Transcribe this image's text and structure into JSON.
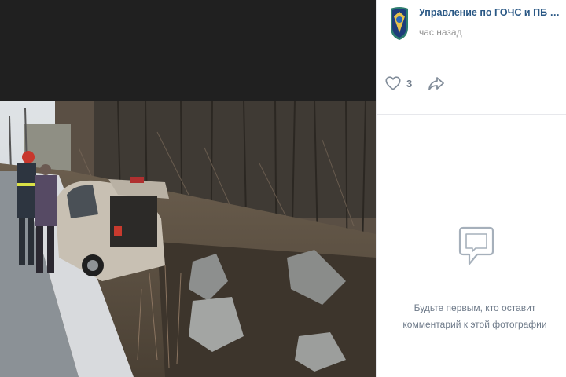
{
  "post": {
    "author": "Управление по ГОЧС и ПБ Мурманской области",
    "time": "час назад",
    "likes": "3"
  },
  "comments": {
    "empty_text": "Будьте первым, кто оставит комментарий к этой фотографии"
  },
  "icons": {
    "avatar": "emblem-shield-icon",
    "like": "heart-outline-icon",
    "share": "share-arrow-icon",
    "empty": "comment-bubble-icon"
  },
  "colors": {
    "link": "#2a5885",
    "muted": "#939393",
    "icon": "#818c99",
    "viewer_bg": "#202020"
  }
}
